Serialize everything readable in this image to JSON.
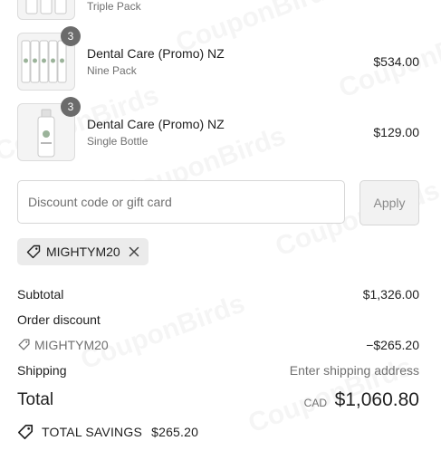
{
  "line_items": [
    {
      "name": "",
      "variant": "Triple Pack",
      "price": "",
      "quantity": ""
    },
    {
      "name": "Dental Care (Promo) NZ",
      "variant": "Nine Pack",
      "price": "$534.00",
      "quantity": "3"
    },
    {
      "name": "Dental Care (Promo) NZ",
      "variant": "Single Bottle",
      "price": "$129.00",
      "quantity": "3"
    }
  ],
  "discount": {
    "placeholder": "Discount code or gift card",
    "value": "",
    "apply_label": "Apply",
    "applied_code": "MIGHTYM20"
  },
  "summary": {
    "subtotal_label": "Subtotal",
    "subtotal_value": "$1,326.00",
    "order_discount_label": "Order discount",
    "discount_code": "MIGHTYM20",
    "discount_value": "−$265.20",
    "shipping_label": "Shipping",
    "shipping_value": "Enter shipping address",
    "total_label": "Total",
    "currency": "CAD",
    "total_value": "$1,060.80",
    "savings_label": "TOTAL SAVINGS",
    "savings_value": "$265.20"
  },
  "watermark": "CouponBirds",
  "icons": {
    "tag": "tag-icon",
    "close": "close-icon",
    "savings": "savings-tag-icon"
  }
}
